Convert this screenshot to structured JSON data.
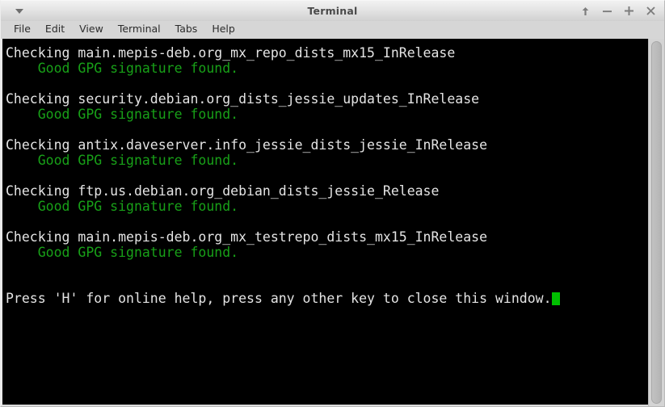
{
  "window": {
    "title": "Terminal",
    "menu_button_icon": "chevron-down-icon",
    "controls": [
      {
        "name": "shade-button",
        "icon": "up-arrow-icon",
        "glyph": "↑"
      },
      {
        "name": "minimize-button",
        "icon": "minus-icon",
        "glyph": "−"
      },
      {
        "name": "maximize-button",
        "icon": "plus-icon",
        "glyph": "+"
      },
      {
        "name": "close-button",
        "icon": "close-icon",
        "glyph": "✕"
      }
    ]
  },
  "menubar": {
    "items": [
      {
        "label": "File"
      },
      {
        "label": "Edit"
      },
      {
        "label": "View"
      },
      {
        "label": "Terminal"
      },
      {
        "label": "Tabs"
      },
      {
        "label": "Help"
      }
    ]
  },
  "terminal": {
    "background": "#000000",
    "foreground": "#e4e4e4",
    "good_color": "#18a018",
    "cursor_color": "#00c000",
    "lines": [
      {
        "type": "check",
        "text": "Checking main.mepis-deb.org_mx_repo_dists_mx15_InRelease"
      },
      {
        "type": "good",
        "text": "    Good GPG signature found."
      },
      {
        "type": "blank",
        "text": " "
      },
      {
        "type": "check",
        "text": "Checking security.debian.org_dists_jessie_updates_InRelease"
      },
      {
        "type": "good",
        "text": "    Good GPG signature found."
      },
      {
        "type": "blank",
        "text": " "
      },
      {
        "type": "check",
        "text": "Checking antix.daveserver.info_jessie_dists_jessie_InRelease"
      },
      {
        "type": "good",
        "text": "    Good GPG signature found."
      },
      {
        "type": "blank",
        "text": " "
      },
      {
        "type": "check",
        "text": "Checking ftp.us.debian.org_debian_dists_jessie_Release"
      },
      {
        "type": "good",
        "text": "    Good GPG signature found."
      },
      {
        "type": "blank",
        "text": " "
      },
      {
        "type": "check",
        "text": "Checking main.mepis-deb.org_mx_testrepo_dists_mx15_InRelease"
      },
      {
        "type": "good",
        "text": "    Good GPG signature found."
      },
      {
        "type": "blank",
        "text": " "
      },
      {
        "type": "blank",
        "text": " "
      },
      {
        "type": "prompt",
        "text": "Press 'H' for online help, press any other key to close this window."
      }
    ]
  },
  "scrollbar": {
    "name": "vertical-scrollbar",
    "thumb_position_percent": 0,
    "thumb_size_percent": 100
  }
}
